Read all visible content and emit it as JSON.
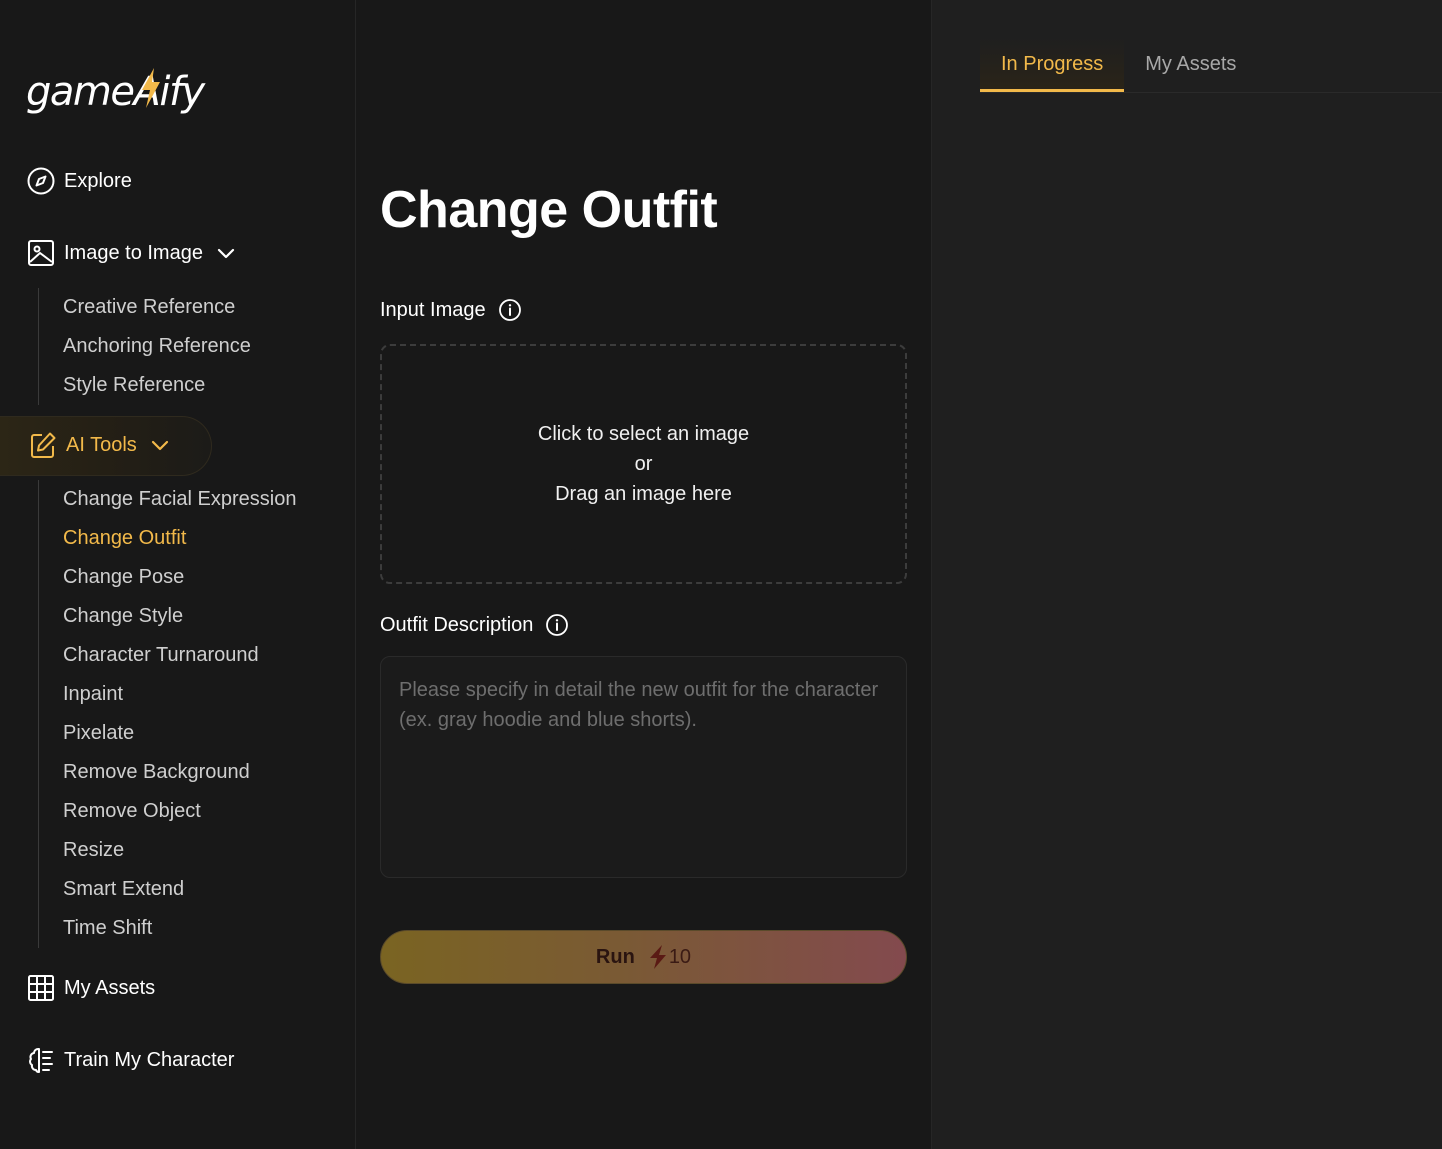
{
  "logo": {
    "text": "gameAify"
  },
  "nav": {
    "explore": "Explore",
    "image_to_image": {
      "label": "Image to Image",
      "items": [
        "Creative Reference",
        "Anchoring Reference",
        "Style Reference"
      ]
    },
    "ai_tools": {
      "label": "AI Tools",
      "items": [
        "Change Facial Expression",
        "Change Outfit",
        "Change Pose",
        "Change Style",
        "Character Turnaround",
        "Inpaint",
        "Pixelate",
        "Remove Background",
        "Remove Object",
        "Resize",
        "Smart Extend",
        "Time Shift"
      ],
      "active_item": "Change Outfit"
    },
    "my_assets": "My Assets",
    "train_my_character": "Train My Character"
  },
  "main": {
    "title": "Change Outfit",
    "input_image": {
      "label": "Input Image",
      "line1": "Click to select an image",
      "line2": "or",
      "line3": "Drag an image here"
    },
    "outfit_description": {
      "label": "Outfit Description",
      "placeholder": "Please specify in detail the new outfit for the character\n(ex. gray hoodie and blue shorts)."
    },
    "run": {
      "label": "Run",
      "cost": "10"
    }
  },
  "right_panel": {
    "tabs": [
      "In Progress",
      "My Assets"
    ],
    "active_tab": "In Progress"
  },
  "colors": {
    "accent": "#f2b94a",
    "background": "#181818",
    "panel": "#1f1f1f"
  }
}
